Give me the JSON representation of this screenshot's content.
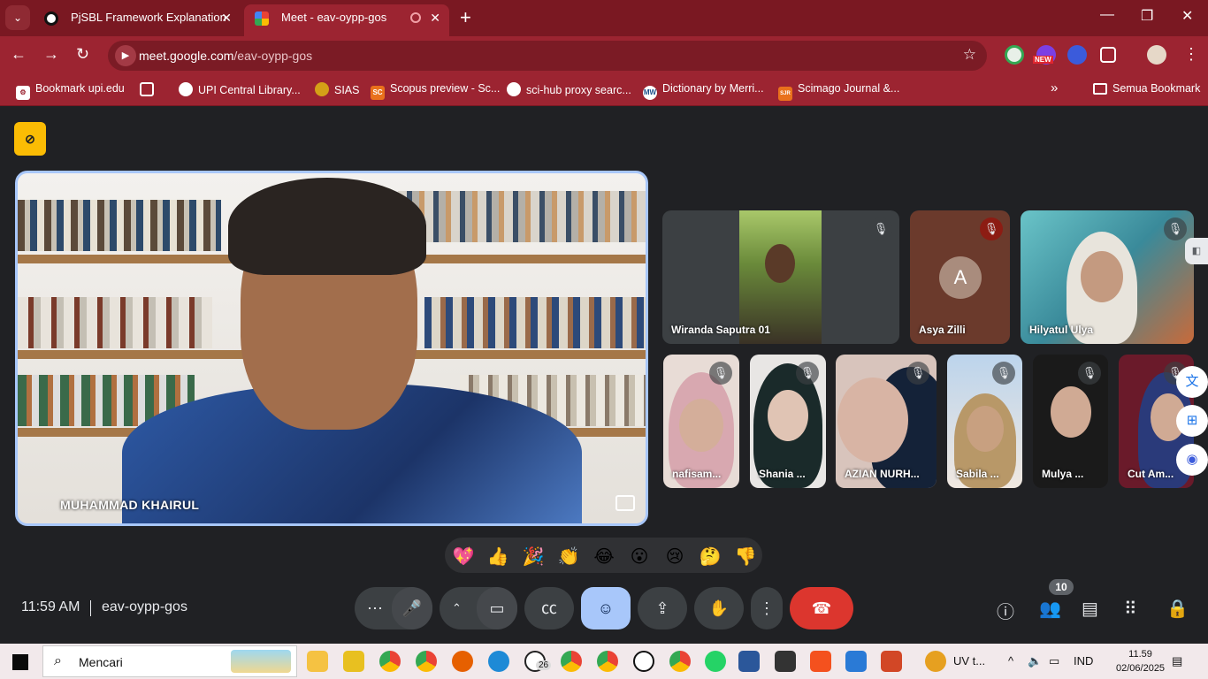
{
  "browser": {
    "tabs": [
      {
        "title": "PjSBL Framework Explanation",
        "favicon": "chatgpt-icon"
      },
      {
        "title": "Meet - eav-oypp-gos",
        "favicon": "meet-icon"
      }
    ],
    "url_host": "meet.google.com",
    "url_path": "/eav-oypp-gos",
    "new_badge": "NEW",
    "bookmarks": [
      "Bookmark upi.edu",
      "UPI Central Library...",
      "SIAS",
      "Scopus preview - Sc...",
      "sci-hub proxy searc...",
      "Dictionary by Merri...",
      "Scimago Journal &...",
      "Semua Bookmark"
    ],
    "bookmark_icons": [
      "SC",
      "MW",
      "SJR"
    ]
  },
  "meet": {
    "main_speaker": "MUHAMMAD KHAIRUL",
    "participants": [
      {
        "name": "Wiranda Saputra 01",
        "muted": true
      },
      {
        "name": "Asya Zilli",
        "muted": true,
        "avatar_letter": "A"
      },
      {
        "name": "Hilyatul Ulya",
        "muted": true
      },
      {
        "name": "nafisam...",
        "muted": true
      },
      {
        "name": "Shania ...",
        "muted": true
      },
      {
        "name": "AZIAN NURH...",
        "muted": true
      },
      {
        "name": "Sabila ...",
        "muted": true
      },
      {
        "name": "Mulya ...",
        "muted": true
      },
      {
        "name": "Cut Am...",
        "muted": true
      }
    ],
    "reactions": [
      "💖",
      "👍",
      "🎉",
      "👏",
      "😂",
      "😮",
      "😢",
      "🤔",
      "👎"
    ],
    "time": "11:59 AM",
    "meeting_code": "eav-oypp-gos",
    "participant_count": "10",
    "colors": {
      "accent_blue": "#a8c7fa",
      "end_call_red": "#dc362e",
      "chrome_red": "#9c2431",
      "background": "#202124"
    }
  },
  "taskbar": {
    "search_placeholder": "Mencari",
    "whatsapp_badge": "26",
    "uv_label": "UV t...",
    "language": "IND",
    "clock_time": "11.59",
    "clock_date": "02/06/2025"
  }
}
